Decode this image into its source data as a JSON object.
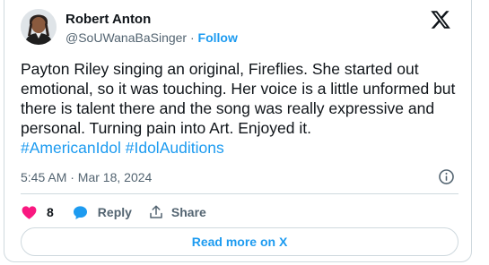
{
  "author": {
    "name": "Robert Anton",
    "handle": "@SoUWanaBaSinger",
    "separator": " · ",
    "follow_label": "Follow"
  },
  "tweet": {
    "text": "Payton Riley singing an original, Fireflies. She started out emotional, so it was touching. Her voice is a little unformed but there is talent there and the song was really expressive and personal. Turning pain into Art. Enjoyed it.",
    "hashtags": [
      "#AmericanIdol",
      "#IdolAuditions"
    ],
    "timestamp": "5:45 AM · Mar 18, 2024"
  },
  "actions": {
    "like_count": "8",
    "reply_label": "Reply",
    "share_label": "Share"
  },
  "read_more_label": "Read more on X",
  "colors": {
    "accent": "#1d9bf0",
    "like": "#f91880",
    "text": "#0f1419",
    "muted": "#536471",
    "border": "#cfd9de"
  },
  "icons": [
    "x-logo-icon",
    "info-icon",
    "heart-icon",
    "reply-bubble-icon",
    "share-icon"
  ]
}
